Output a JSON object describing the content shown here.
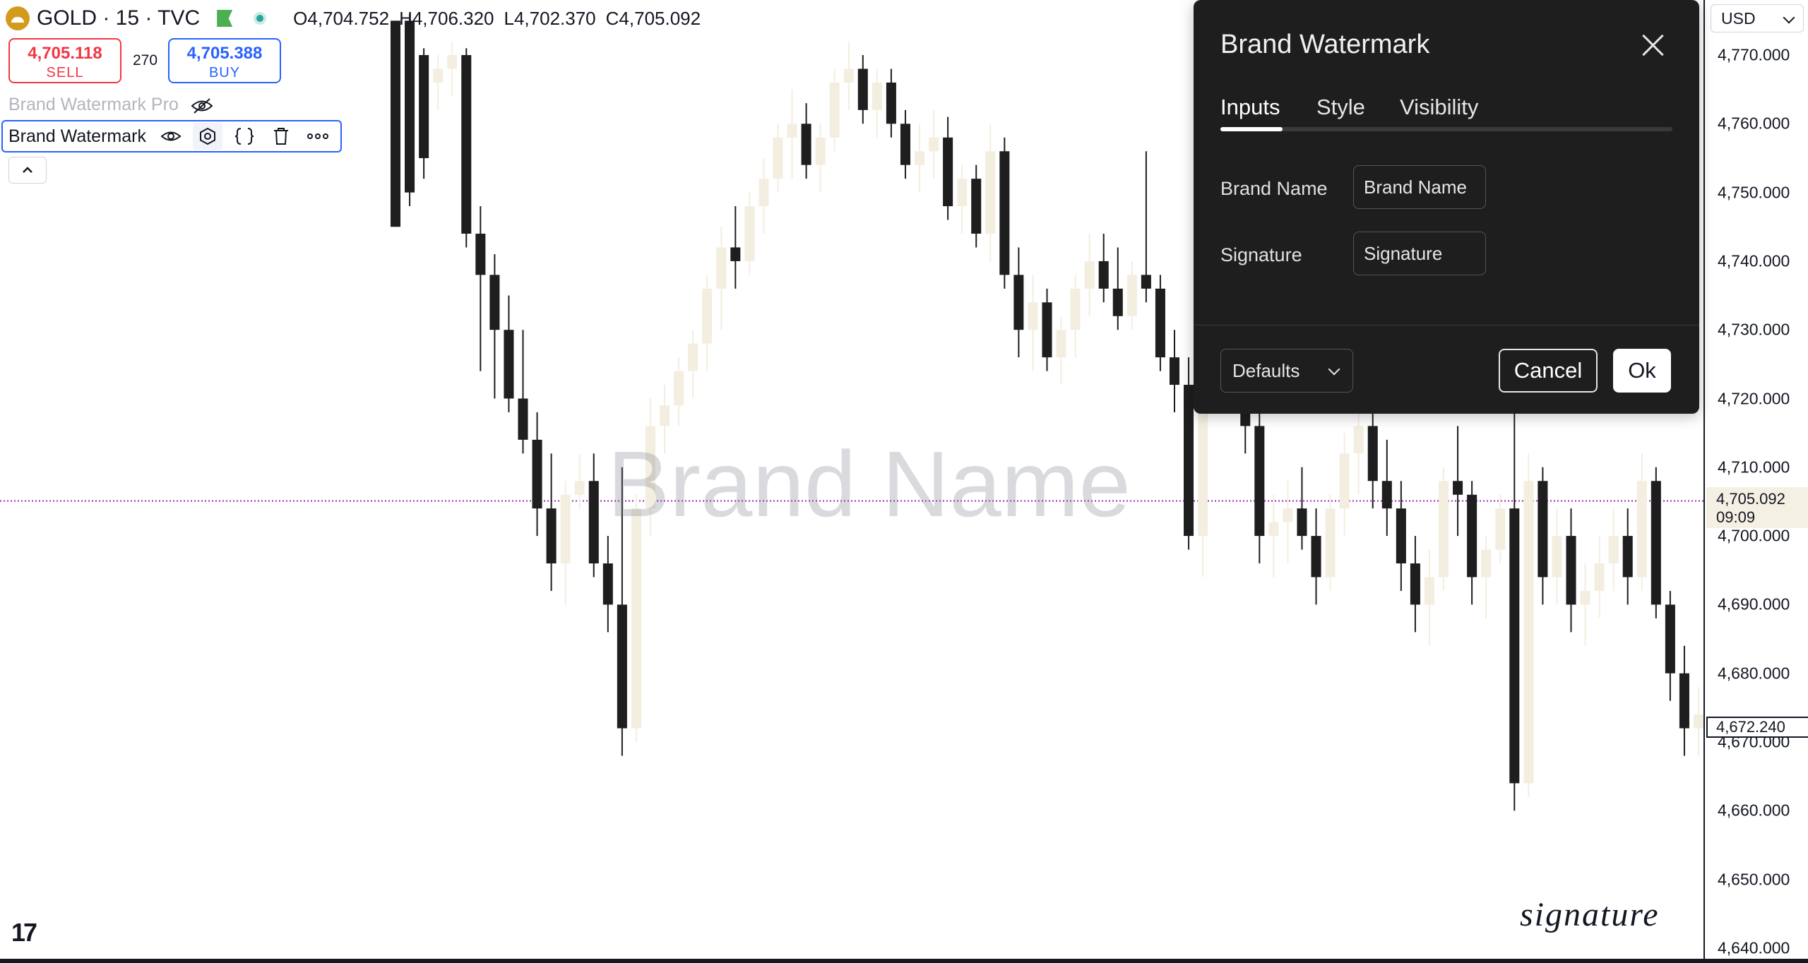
{
  "symbol": {
    "name": "GOLD · 15 · TVC",
    "open": "O4,704.752",
    "high": "H4,706.320",
    "low": "L4,702.370",
    "close": "C4,705.092"
  },
  "trade": {
    "sell_price": "4,705.118",
    "sell_label": "SELL",
    "spread": "270",
    "buy_price": "4,705.388",
    "buy_label": "BUY"
  },
  "indicators": {
    "pro_name": "Brand Watermark Pro",
    "active_name": "Brand Watermark"
  },
  "watermark": {
    "brand_text": "Brand Name",
    "signature_text": "signature"
  },
  "logo_text": "17",
  "price_axis": {
    "currency": "USD",
    "ticks": [
      "4,770.000",
      "4,760.000",
      "4,750.000",
      "4,740.000",
      "4,730.000",
      "4,720.000",
      "4,710.000",
      "4,700.000",
      "4,690.000",
      "4,680.000",
      "4,670.000",
      "4,660.000",
      "4,650.000",
      "4,640.000"
    ],
    "last_price": "4,705.092",
    "countdown": "09:09",
    "crosshair_price": "4,672.240"
  },
  "dialog": {
    "title": "Brand Watermark",
    "tabs": [
      "Inputs",
      "Style",
      "Visibility"
    ],
    "active_tab": "Inputs",
    "fields": [
      {
        "label": "Brand Name",
        "value": "Brand Name"
      },
      {
        "label": "Signature",
        "value": "Signature"
      }
    ],
    "defaults_label": "Defaults",
    "cancel_label": "Cancel",
    "ok_label": "Ok"
  },
  "colors": {
    "sell": "#f23645",
    "buy": "#2962ff",
    "candle_down": "#1e1e1e",
    "candle_up": "#f3eee0",
    "last_price_line": "#9c27b0"
  },
  "chart_data": {
    "type": "candlestick",
    "ylim": [
      4638,
      4775
    ],
    "last_price_line": 4705.092,
    "candles": [
      [
        4775,
        4775,
        4745,
        4745
      ],
      [
        4775,
        4776,
        4748,
        4750
      ],
      [
        4770,
        4771,
        4752,
        4755
      ],
      [
        4766,
        4770,
        4762,
        4768
      ],
      [
        4768,
        4772,
        4764,
        4770
      ],
      [
        4770,
        4771,
        4742,
        4744
      ],
      [
        4744,
        4748,
        4724,
        4738
      ],
      [
        4738,
        4741,
        4720,
        4730
      ],
      [
        4730,
        4735,
        4718,
        4720
      ],
      [
        4720,
        4730,
        4712,
        4714
      ],
      [
        4714,
        4718,
        4700,
        4704
      ],
      [
        4704,
        4712,
        4692,
        4696
      ],
      [
        4696,
        4708,
        4690,
        4706
      ],
      [
        4706,
        4712,
        4704,
        4708
      ],
      [
        4708,
        4712,
        4694,
        4696
      ],
      [
        4696,
        4700,
        4686,
        4690
      ],
      [
        4690,
        4710,
        4668,
        4672
      ],
      [
        4672,
        4706,
        4670,
        4704
      ],
      [
        4704,
        4720,
        4700,
        4716
      ],
      [
        4716,
        4722,
        4712,
        4719
      ],
      [
        4719,
        4726,
        4716,
        4724
      ],
      [
        4724,
        4730,
        4720,
        4728
      ],
      [
        4728,
        4738,
        4724,
        4736
      ],
      [
        4736,
        4745,
        4730,
        4742
      ],
      [
        4742,
        4748,
        4736,
        4740
      ],
      [
        4740,
        4750,
        4738,
        4748
      ],
      [
        4748,
        4755,
        4744,
        4752
      ],
      [
        4752,
        4760,
        4750,
        4758
      ],
      [
        4758,
        4765,
        4752,
        4760
      ],
      [
        4760,
        4763,
        4752,
        4754
      ],
      [
        4754,
        4760,
        4750,
        4758
      ],
      [
        4758,
        4768,
        4756,
        4766
      ],
      [
        4766,
        4772,
        4762,
        4768
      ],
      [
        4768,
        4770,
        4760,
        4762
      ],
      [
        4762,
        4768,
        4758,
        4766
      ],
      [
        4766,
        4768,
        4758,
        4760
      ],
      [
        4760,
        4762,
        4752,
        4754
      ],
      [
        4754,
        4760,
        4750,
        4756
      ],
      [
        4756,
        4762,
        4752,
        4758
      ],
      [
        4758,
        4761,
        4746,
        4748
      ],
      [
        4748,
        4754,
        4744,
        4752
      ],
      [
        4752,
        4754,
        4742,
        4744
      ],
      [
        4744,
        4760,
        4740,
        4756
      ],
      [
        4756,
        4758,
        4736,
        4738
      ],
      [
        4738,
        4742,
        4726,
        4730
      ],
      [
        4730,
        4738,
        4724,
        4734
      ],
      [
        4734,
        4736,
        4724,
        4726
      ],
      [
        4726,
        4732,
        4722,
        4730
      ],
      [
        4730,
        4738,
        4726,
        4736
      ],
      [
        4736,
        4744,
        4732,
        4740
      ],
      [
        4740,
        4744,
        4734,
        4736
      ],
      [
        4736,
        4742,
        4730,
        4732
      ],
      [
        4732,
        4740,
        4730,
        4738
      ],
      [
        4738,
        4756,
        4734,
        4736
      ],
      [
        4736,
        4738,
        4724,
        4726
      ],
      [
        4726,
        4730,
        4718,
        4722
      ],
      [
        4722,
        4726,
        4698,
        4700
      ],
      [
        4700,
        4736,
        4694,
        4732
      ],
      [
        4732,
        4755,
        4728,
        4750
      ],
      [
        4750,
        4752,
        4724,
        4728
      ],
      [
        4728,
        4730,
        4712,
        4716
      ],
      [
        4716,
        4718,
        4696,
        4700
      ],
      [
        4700,
        4706,
        4694,
        4702
      ],
      [
        4702,
        4708,
        4696,
        4704
      ],
      [
        4704,
        4710,
        4698,
        4700
      ],
      [
        4700,
        4704,
        4690,
        4694
      ],
      [
        4694,
        4706,
        4692,
        4704
      ],
      [
        4704,
        4715,
        4700,
        4712
      ],
      [
        4712,
        4720,
        4706,
        4716
      ],
      [
        4716,
        4720,
        4704,
        4708
      ],
      [
        4708,
        4714,
        4700,
        4704
      ],
      [
        4704,
        4708,
        4692,
        4696
      ],
      [
        4696,
        4700,
        4686,
        4690
      ],
      [
        4690,
        4698,
        4684,
        4694
      ],
      [
        4694,
        4710,
        4692,
        4708
      ],
      [
        4708,
        4716,
        4700,
        4706
      ],
      [
        4706,
        4708,
        4690,
        4694
      ],
      [
        4694,
        4700,
        4688,
        4698
      ],
      [
        4698,
        4706,
        4696,
        4704
      ],
      [
        4704,
        4718,
        4660,
        4664
      ],
      [
        4664,
        4712,
        4662,
        4708
      ],
      [
        4708,
        4710,
        4690,
        4694
      ],
      [
        4694,
        4704,
        4690,
        4700
      ],
      [
        4700,
        4704,
        4686,
        4690
      ],
      [
        4690,
        4696,
        4684,
        4692
      ],
      [
        4692,
        4700,
        4688,
        4696
      ],
      [
        4696,
        4704,
        4692,
        4700
      ],
      [
        4700,
        4704,
        4690,
        4694
      ],
      [
        4694,
        4712,
        4692,
        4708
      ],
      [
        4708,
        4710,
        4688,
        4690
      ],
      [
        4690,
        4692,
        4676,
        4680
      ],
      [
        4680,
        4684,
        4668,
        4672
      ],
      [
        4672,
        4678,
        4668,
        4674
      ]
    ]
  }
}
